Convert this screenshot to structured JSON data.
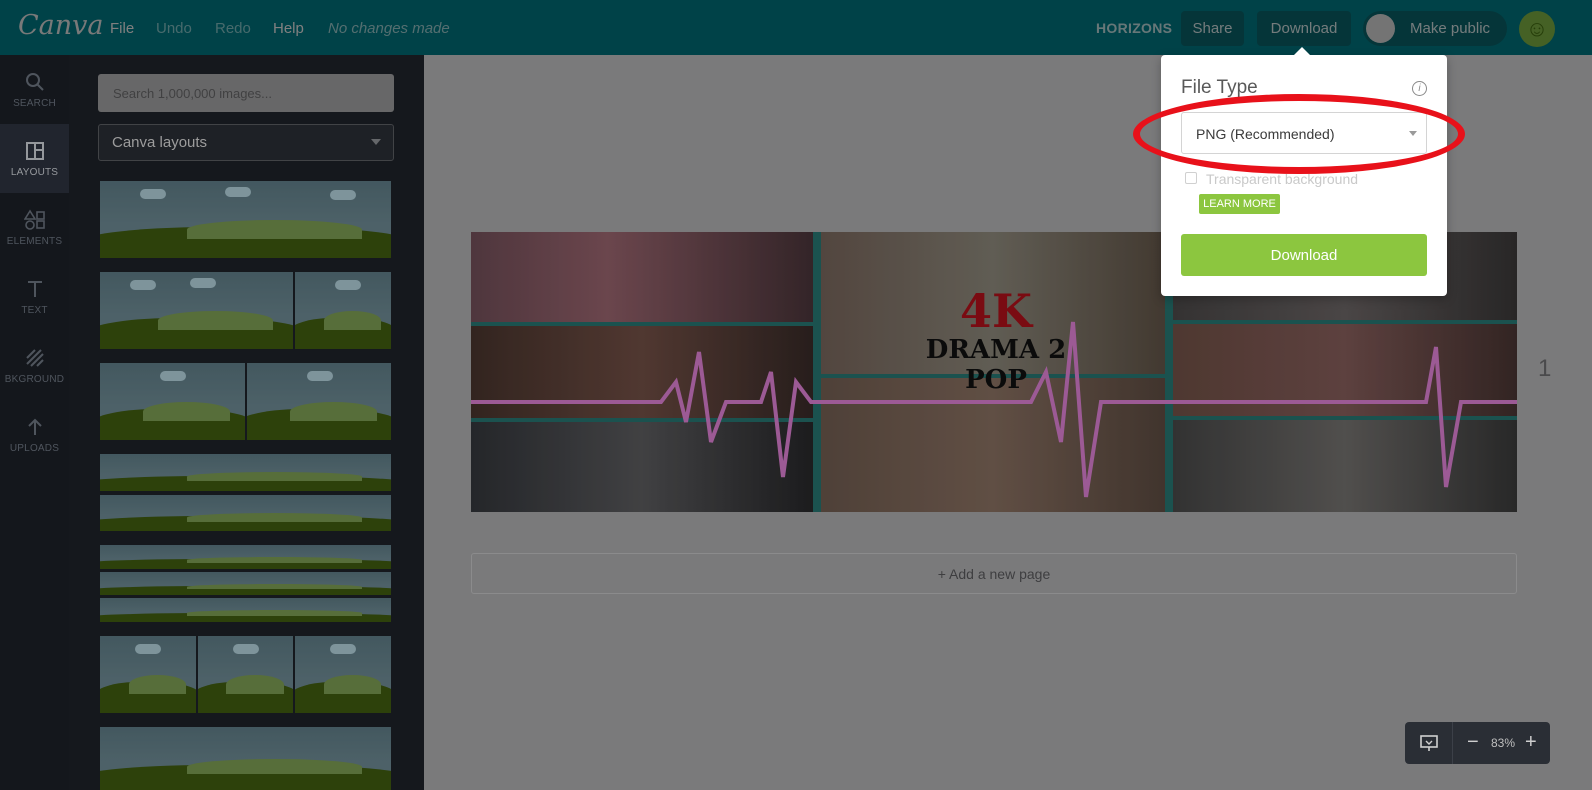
{
  "topbar": {
    "logo": "Canva",
    "menu": {
      "file": "File",
      "undo": "Undo",
      "redo": "Redo",
      "help": "Help"
    },
    "status": "No changes made",
    "team": "HORIZONS",
    "share": "Share",
    "download": "Download",
    "make_public": "Make public"
  },
  "rail": {
    "search": "SEARCH",
    "layouts": "LAYOUTS",
    "elements": "ELEMENTS",
    "text": "TEXT",
    "background": "BKGROUND",
    "uploads": "UPLOADS"
  },
  "panel": {
    "search_placeholder": "Search 1,000,000 images...",
    "category": "Canva layouts"
  },
  "design": {
    "title_big": "4K",
    "title_line2": "DRAMA 2",
    "title_line3": "POP"
  },
  "canvas": {
    "add_page": "+ Add a new page",
    "page_number": "1"
  },
  "zoom": {
    "minus": "−",
    "value": "83%",
    "plus": "+"
  },
  "download_popover": {
    "title": "File Type",
    "info": "i",
    "file_type_value": "PNG (Recommended)",
    "transparent_label": "Transparent background",
    "learn_more": "LEARN MORE",
    "download_button": "Download"
  },
  "colors": {
    "topbar": "#008590",
    "accent_green": "#8cc63f",
    "annotation_red": "#e8111a"
  }
}
